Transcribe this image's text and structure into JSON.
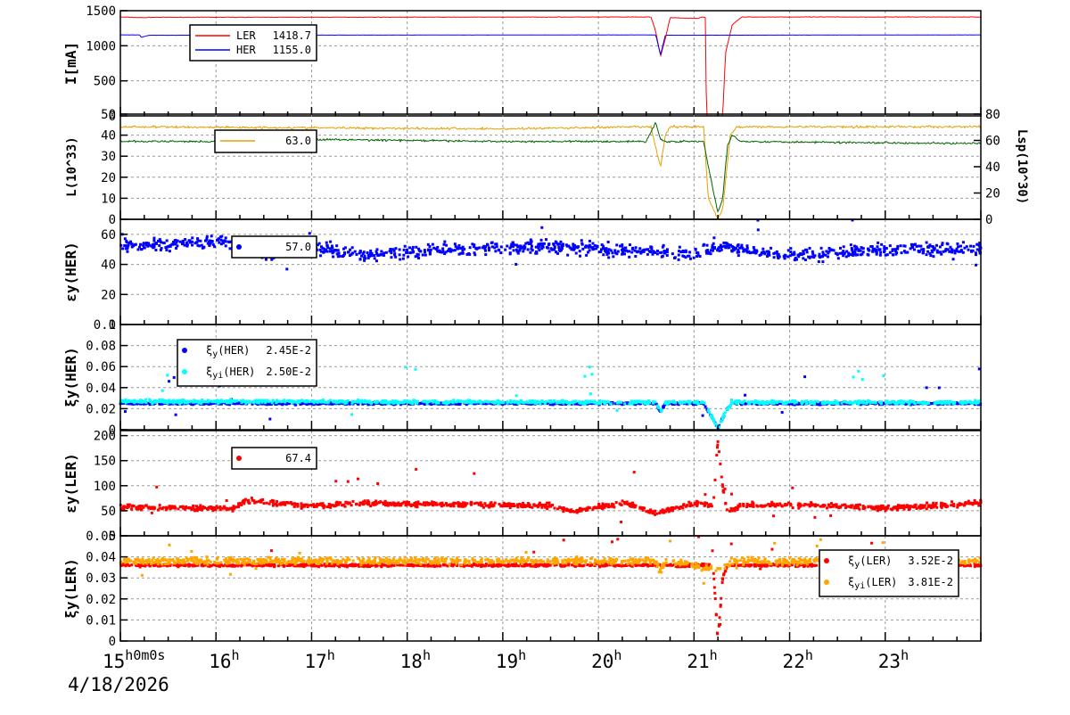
{
  "chart_data": {
    "type": "line",
    "xlabel": "time",
    "x_range_hours": [
      15,
      24
    ],
    "x_ticks": [
      {
        "h": 15,
        "label": "15",
        "suffix": "h0m0s"
      },
      {
        "h": 16,
        "label": "16",
        "suffix": "h"
      },
      {
        "h": 17,
        "label": "17",
        "suffix": "h"
      },
      {
        "h": 18,
        "label": "18",
        "suffix": "h"
      },
      {
        "h": 19,
        "label": "19",
        "suffix": "h"
      },
      {
        "h": 20,
        "label": "20",
        "suffix": "h"
      },
      {
        "h": 21,
        "label": "21",
        "suffix": "h"
      },
      {
        "h": 22,
        "label": "22",
        "suffix": "h"
      },
      {
        "h": 23,
        "label": "23",
        "suffix": "h"
      }
    ],
    "date": "4/18/2026",
    "panels": [
      {
        "ylabel": "I[mA]",
        "ylim": [
          0,
          1500
        ],
        "yticks": [
          "0",
          "500",
          "1000",
          "1500"
        ],
        "legend": [
          {
            "name": "LER",
            "value": "1418.7",
            "color": "#ff0000"
          },
          {
            "name": "HER",
            "value": "1155.0",
            "color": "#0000ff"
          }
        ],
        "series": [
          {
            "name": "LER",
            "kind": "line",
            "color": "#ff0000",
            "noise": 5,
            "points": [
              [
                15,
                1410
              ],
              [
                15.25,
                1400
              ],
              [
                15.3,
                1405
              ],
              [
                20.55,
                1410
              ],
              [
                20.6,
                1200
              ],
              [
                20.65,
                850
              ],
              [
                20.7,
                1100
              ],
              [
                20.75,
                1400
              ],
              [
                21.05,
                1390
              ],
              [
                21.08,
                1410
              ],
              [
                21.12,
                1400
              ],
              [
                21.13,
                0
              ],
              [
                21.3,
                0
              ],
              [
                21.33,
                900
              ],
              [
                21.4,
                1300
              ],
              [
                21.5,
                1410
              ],
              [
                24,
                1410
              ]
            ]
          },
          {
            "name": "HER",
            "kind": "line",
            "color": "#0000ff",
            "noise": 2,
            "points": [
              [
                15,
                1155
              ],
              [
                15.2,
                1155
              ],
              [
                15.22,
                1120
              ],
              [
                15.3,
                1150
              ],
              [
                20.6,
                1155
              ],
              [
                20.65,
                870
              ],
              [
                20.7,
                1150
              ],
              [
                24,
                1155
              ]
            ]
          }
        ]
      },
      {
        "ylabel": "L(10^33)",
        "ylim": [
          0,
          50
        ],
        "yticks": [
          "0",
          "10",
          "20",
          "30",
          "40",
          "50"
        ],
        "y2label": "Lsp(10^30)",
        "y2ticks": [
          "0",
          "20",
          "40",
          "60",
          "80"
        ],
        "legend": [
          {
            "name": "",
            "value": "63.0",
            "color": "#e6a000"
          }
        ],
        "series": [
          {
            "name": "L",
            "kind": "line",
            "color": "#e6a000",
            "noise": 0.8,
            "points": [
              [
                15,
                44
              ],
              [
                19,
                43
              ],
              [
                20.55,
                44
              ],
              [
                20.62,
                30
              ],
              [
                20.65,
                25
              ],
              [
                20.7,
                40
              ],
              [
                20.75,
                44
              ],
              [
                21.1,
                44
              ],
              [
                21.15,
                10
              ],
              [
                21.25,
                0
              ],
              [
                21.3,
                5
              ],
              [
                21.38,
                40
              ],
              [
                21.45,
                44
              ],
              [
                24,
                44
              ]
            ]
          },
          {
            "name": "Lsp",
            "kind": "line",
            "color": "#006400",
            "noise": 0.7,
            "points": [
              [
                15,
                37
              ],
              [
                16.5,
                37
              ],
              [
                17,
                38
              ],
              [
                19,
                37
              ],
              [
                20.5,
                37
              ],
              [
                20.6,
                46
              ],
              [
                20.65,
                38
              ],
              [
                20.7,
                37
              ],
              [
                21.1,
                37
              ],
              [
                21.15,
                25
              ],
              [
                21.25,
                3
              ],
              [
                21.3,
                10
              ],
              [
                21.35,
                35
              ],
              [
                21.4,
                40
              ],
              [
                21.5,
                37
              ],
              [
                24,
                36
              ]
            ]
          }
        ]
      },
      {
        "ylabel": "εy(HER)",
        "ylim": [
          0,
          70
        ],
        "yticks": [
          "0",
          "20",
          "40",
          "60"
        ],
        "legend": [
          {
            "name": "",
            "value": "57.0",
            "color": "#0000ff"
          }
        ],
        "series": [
          {
            "name": "εy(HER)",
            "kind": "scatter",
            "color": "#0000ff",
            "noise": 4,
            "points": [
              [
                15,
                52
              ],
              [
                16.2,
                55
              ],
              [
                16.5,
                46
              ],
              [
                17,
                52
              ],
              [
                17.5,
                46
              ],
              [
                18.5,
                50
              ],
              [
                19.5,
                52
              ],
              [
                20,
                50
              ],
              [
                21,
                47
              ],
              [
                21.3,
                52
              ],
              [
                22,
                46
              ],
              [
                23,
                50
              ],
              [
                24,
                50
              ]
            ]
          }
        ]
      },
      {
        "ylabel": "ξy(HER)",
        "ylim": [
          0,
          0.1
        ],
        "yticks": [
          "0",
          "0.02",
          "0.04",
          "0.06",
          "0.08",
          "0.1"
        ],
        "legend": [
          {
            "name": "ξy(HER)",
            "value": "2.45E-2",
            "color": "#0000ff"
          },
          {
            "name": "ξyi(HER)",
            "value": "2.50E-2",
            "color": "#00ffff"
          }
        ],
        "series": [
          {
            "name": "ξy(HER)",
            "kind": "scatter",
            "color": "#0000ff",
            "noise": 0.001,
            "points": [
              [
                15,
                0.025
              ],
              [
                20.6,
                0.025
              ],
              [
                20.65,
                0.017
              ],
              [
                20.7,
                0.025
              ],
              [
                21.1,
                0.025
              ],
              [
                21.25,
                0.002
              ],
              [
                21.35,
                0.02
              ],
              [
                21.4,
                0.025
              ],
              [
                24,
                0.025
              ]
            ]
          },
          {
            "name": "ξyi(HER)",
            "kind": "scatter",
            "color": "#00ffff",
            "noise": 0.0015,
            "points": [
              [
                15,
                0.027
              ],
              [
                20.6,
                0.026
              ],
              [
                20.65,
                0.017
              ],
              [
                20.7,
                0.026
              ],
              [
                21.1,
                0.026
              ],
              [
                21.25,
                0.002
              ],
              [
                21.35,
                0.02
              ],
              [
                21.4,
                0.026
              ],
              [
                24,
                0.026
              ]
            ]
          }
        ]
      },
      {
        "ylabel": "εy(LER)",
        "ylim": [
          0,
          210
        ],
        "yticks": [
          "0",
          "50",
          "100",
          "150",
          "200"
        ],
        "legend": [
          {
            "name": "",
            "value": "67.4",
            "color": "#ff0000"
          }
        ],
        "series": [
          {
            "name": "εy(LER)",
            "kind": "scatter",
            "color": "#ff0000",
            "noise": 5,
            "points": [
              [
                15,
                57
              ],
              [
                16.2,
                55
              ],
              [
                16.3,
                70
              ],
              [
                17,
                60
              ],
              [
                17.5,
                65
              ],
              [
                19.5,
                60
              ],
              [
                19.7,
                50
              ],
              [
                20.3,
                65
              ],
              [
                20.6,
                45
              ],
              [
                21,
                65
              ],
              [
                21.2,
                60
              ],
              [
                21.25,
                190
              ],
              [
                21.3,
                100
              ],
              [
                21.35,
                45
              ],
              [
                21.5,
                62
              ],
              [
                22.5,
                60
              ],
              [
                23,
                55
              ],
              [
                24,
                65
              ]
            ]
          }
        ]
      },
      {
        "ylabel": "ξy(LER)",
        "ylim": [
          0,
          0.05
        ],
        "yticks": [
          "0",
          "0.01",
          "0.02",
          "0.03",
          "0.04",
          "0.05"
        ],
        "legend": [
          {
            "name": "ξy(LER)",
            "value": "3.52E-2",
            "color": "#ff0000"
          },
          {
            "name": "ξyi(LER)",
            "value": "3.81E-2",
            "color": "#ffa500"
          }
        ],
        "series": [
          {
            "name": "ξy(LER)",
            "kind": "scatter",
            "color": "#ff0000",
            "noise": 0.0006,
            "points": [
              [
                15,
                0.036
              ],
              [
                21.2,
                0.036
              ],
              [
                21.25,
                0.0
              ],
              [
                21.3,
                0.03
              ],
              [
                21.35,
                0.036
              ],
              [
                24,
                0.036
              ]
            ]
          },
          {
            "name": "ξyi(LER)",
            "kind": "scatter",
            "color": "#ffa500",
            "noise": 0.0015,
            "points": [
              [
                15,
                0.038
              ],
              [
                20.6,
                0.038
              ],
              [
                20.65,
                0.033
              ],
              [
                20.7,
                0.038
              ],
              [
                21.1,
                0.035
              ],
              [
                21.25,
                0.034
              ],
              [
                21.4,
                0.038
              ],
              [
                24,
                0.038
              ]
            ]
          }
        ]
      }
    ]
  }
}
